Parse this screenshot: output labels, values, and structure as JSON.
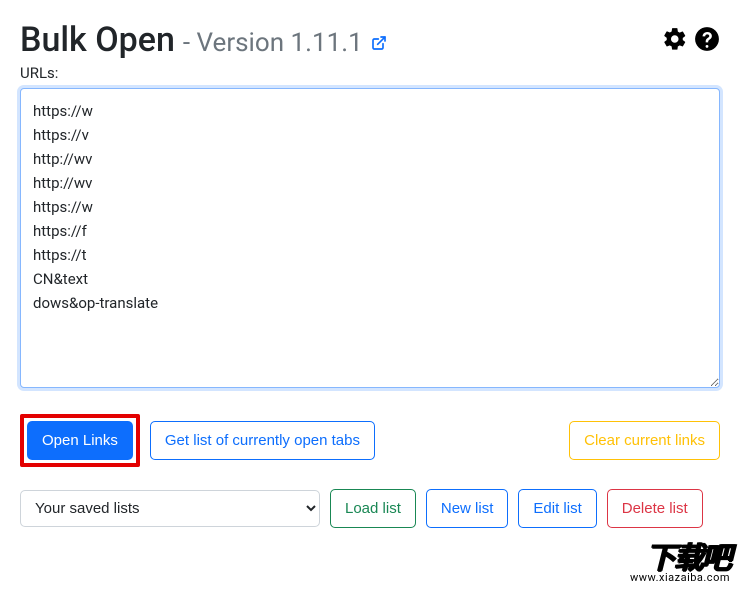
{
  "header": {
    "title": "Bulk Open",
    "version_prefix": "- Version ",
    "version": "1.11.1"
  },
  "labels": {
    "urls": "URLs:"
  },
  "textarea": {
    "value": "https://w\nhttps://v\nhttp://wv\nhttp://wv\nhttps://w\nhttps://f\nhttps://t\nCN&text\ndows&op-translate\n"
  },
  "buttons": {
    "open_links": "Open Links",
    "get_tabs": "Get list of currently open tabs",
    "clear_links": "Clear current links",
    "load_list": "Load list",
    "new_list": "New list",
    "edit_list": "Edit list",
    "delete_list": "Delete list"
  },
  "select": {
    "placeholder": "Your saved lists"
  },
  "watermark": {
    "main": "下载吧",
    "sub": "www.xiazaiba.com"
  }
}
